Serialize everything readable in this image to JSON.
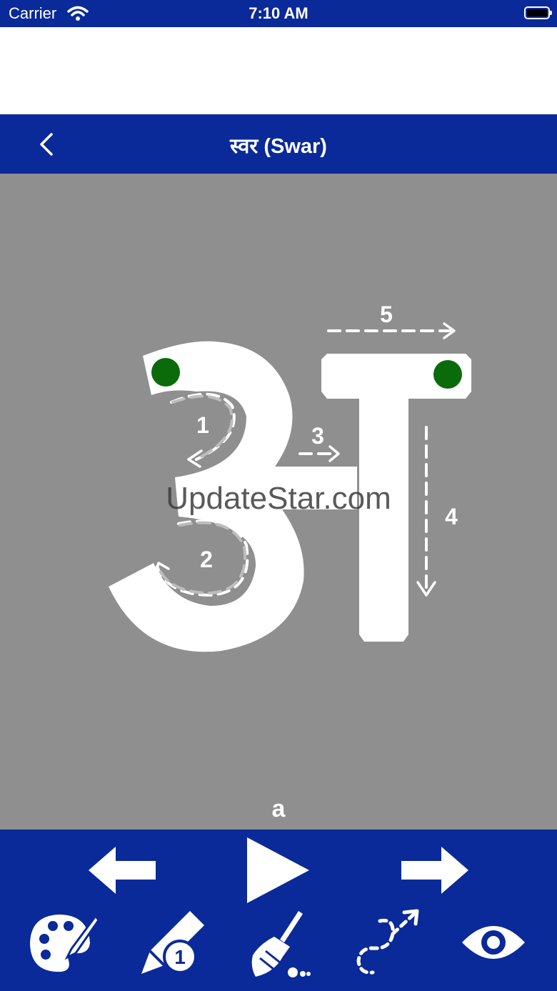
{
  "status_bar": {
    "carrier": "Carrier",
    "time": "7:10 AM"
  },
  "nav": {
    "title": "स्वर (Swar)",
    "back_icon": "chevron-left-icon"
  },
  "tracing": {
    "stroke_numbers": [
      "1",
      "2",
      "3",
      "4",
      "5"
    ],
    "watermark": "UpdateStar.com",
    "caption": "a",
    "colors": {
      "background": "#8f8f8f",
      "letter": "#ffffff",
      "start_dot": "#0b6b0b",
      "bars": "#0a2a99"
    }
  },
  "toolbar": {
    "top_row": [
      "previous-arrow-icon",
      "play-icon",
      "next-arrow-icon"
    ],
    "bottom_row": [
      "palette-icon",
      "pencil-size-icon",
      "broom-icon",
      "trace-path-icon",
      "eye-icon"
    ],
    "pencil_size": "1"
  }
}
